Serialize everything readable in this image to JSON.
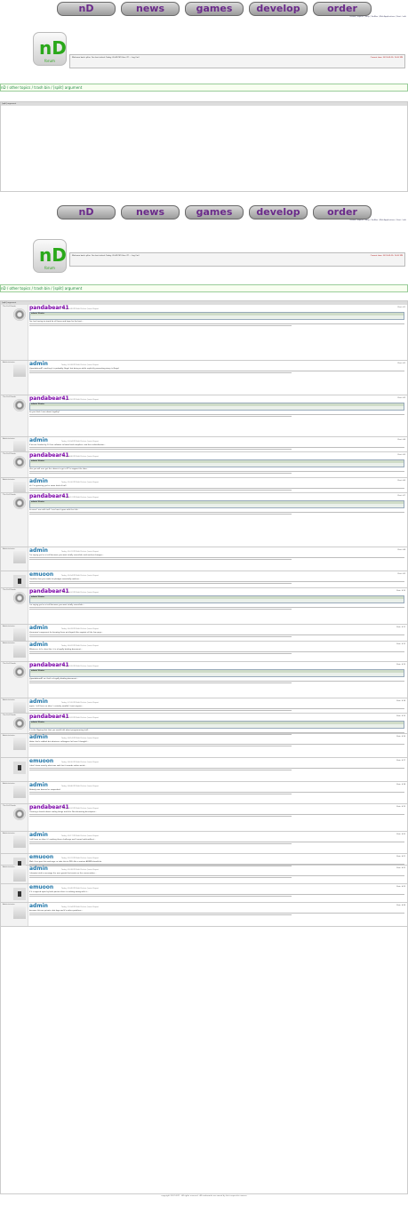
{
  "nav": {
    "buttons": [
      "nD",
      "news",
      "games",
      "develop",
      "order"
    ]
  },
  "toplinks": "Forum | Imprint | Help | ToolBox | Web Applications | Start / wiki",
  "welcome": {
    "text": "Welcome back, qilim. You last visited: Today, 09:49 PM (User CP — Log Out)",
    "sub": "View New Posts | View Today's Posts | Private Messages (Unread 0, Total 17)",
    "current_time": "Current time: 2011-09-15, 10:22 PM"
  },
  "breadcrumb": "nD / other topics / trash bin / [split] argument",
  "thread_title": "[split] argument",
  "posts": [
    {
      "user": "pandabear41",
      "role": "The Evil Panda",
      "type": "pb",
      "meta": "Today, 01:49 PM   Edit Delete Quote Report",
      "no": "Post: #1",
      "quote_by": "admin Wrote:",
      "text": "Yes, but having to stand for all hours and hope for the best..."
    },
    {
      "user": "admin",
      "role": "Administrator",
      "type": "ad",
      "meta": "Today, 02:08 PM   Edit Delete Quote Report",
      "no": "Post: #2",
      "quote_by": "",
      "text": "@pandabear41 cracking it is probably illegal, but doing so while explicitly promoting piracy is illegal."
    },
    {
      "user": "pandabear41",
      "role": "The Evil Panda",
      "type": "pb",
      "meta": "Today, 02:50 PM   Edit Delete Quote Report",
      "no": "Post: #3",
      "quote_by": "admin Wrote:",
      "text": "So you think I care about legality?"
    },
    {
      "user": "admin",
      "role": "Administrator",
      "type": "ad",
      "meta": "Today, 03:04 PM   Edit Delete Quote Report",
      "no": "Post: #4",
      "quote_by": "",
      "text": "If we are funded by 10 free software to board and compilers, and free redistribution..."
    },
    {
      "user": "pandabear41",
      "role": "The Evil Panda",
      "type": "pb",
      "meta": "Today, 04:40 PM   Edit Delete Quote Report",
      "no": "Post: #5",
      "quote_by": "admin Wrote:",
      "text": "Like you will ever get the chance to get a PC to support the idea..."
    },
    {
      "user": "admin",
      "role": "Administrator",
      "type": "ad",
      "meta": "Today, 05:00 PM   Edit Delete Quote Report",
      "no": "Post: #6",
      "quote_by": "",
      "text": "ok, I'm guessing you're some kind of troll."
    },
    {
      "user": "pandabear41",
      "role": "The Evil Panda",
      "type": "pb",
      "meta": "Today, 05:12 PM   Edit Delete Quote Report",
      "no": "Post: #7",
      "quote_by": "admin Wrote:",
      "text": "So were I one with troll. I see how it goes with the title..."
    },
    {
      "user": "admin",
      "role": "Administrator",
      "type": "ad",
      "meta": "Today, 05:31 PM   Edit Delete Quote Report",
      "no": "Post: #8",
      "quote_by": "",
      "text": "I'm saying you're a troll because you want totally unrealistic and useless changes..."
    },
    {
      "user": "emuoon",
      "role": "",
      "type": "em",
      "meta": "Today, 05:54 PM   Edit Delete Quote Report",
      "no": "Post: #9",
      "quote_by": "",
      "text": "Could be that you made his pledges essentially useless..."
    },
    {
      "user": "pandabear41",
      "role": "The Evil Panda",
      "type": "pb",
      "meta": "Today, 06:02 PM   Edit Delete Quote Report",
      "no": "Post: #10",
      "quote_by": "admin Wrote:",
      "text": "I'm saying you're a troll because you want totally unrealistic..."
    },
    {
      "user": "admin",
      "role": "Administrator",
      "type": "ad",
      "meta": "Today, 06:28 PM   Edit Delete Quote Report",
      "no": "Post: #11",
      "quote_by": "",
      "text": "@emuoon's argument for keeping these privileged titles against all the few guys..."
    },
    {
      "user": "admin",
      "role": "Administrator",
      "type": "ad",
      "meta": "Today, 06:41 PM   Edit Delete Quote Report",
      "no": "Post: #12",
      "quote_by": "",
      "text": "Whatever, let's close this, it is a legally binding document..."
    },
    {
      "user": "pandabear41",
      "role": "The Evil Panda",
      "type": "pb",
      "meta": "Today, 07:09 PM   Edit Delete Quote Report",
      "no": "Post: #13",
      "quote_by": "admin Wrote:",
      "text": "@pandabear41 so, that's a legally binding document..."
    },
    {
      "user": "admin",
      "role": "Administrator",
      "type": "ad",
      "meta": "Today, 07:26 PM   Edit Delete Quote Report",
      "no": "Post: #14",
      "quote_by": "",
      "text": "again, I still have no idea, I certainly wouldn't trust anyone..."
    },
    {
      "user": "pandabear41",
      "role": "The Evil Panda",
      "type": "pb",
      "meta": "Today, 07:41 PM   Edit Delete Quote Report",
      "no": "Post: #15",
      "quote_by": "admin Wrote:",
      "text": "It is the flipping that that you would talk about programming stuff..."
    },
    {
      "user": "admin",
      "role": "Administrator",
      "type": "ad",
      "meta": "Today, 08:14 PM   Edit Delete Quote Report",
      "no": "Post: #16",
      "quote_by": "",
      "text": "Haha, that's rubbish but whatever colleagues (at least I thought)..."
    },
    {
      "user": "emuoon",
      "role": "",
      "type": "em",
      "meta": "Today, 08:30 PM   Edit Delete Quote Report",
      "no": "Post: #17",
      "quote_by": "",
      "text": "I don't know exactly what was said, but it sounds rather weird..."
    },
    {
      "user": "admin",
      "role": "Administrator",
      "type": "ad",
      "meta": "Today, 08:46 PM   Edit Delete Quote Report",
      "no": "Post: #18",
      "quote_by": "",
      "text": "Nobody was banned or suspended."
    },
    {
      "user": "pandabear41",
      "role": "The Evil Panda",
      "type": "pb",
      "meta": "Today, 09:02 PM   Edit Delete Quote Report",
      "no": "Post: #19",
      "quote_by": "",
      "text": "Creating a hostile about coding things and this. Not alienating developers..."
    },
    {
      "user": "admin",
      "role": "Administrator",
      "type": "ad",
      "meta": "Today, 09:17 PM   Edit Delete Quote Report",
      "no": "Post: #20",
      "quote_by": "",
      "text": "I still have no idea, it's making these challenge and I sound unfriendliest..."
    },
    {
      "user": "emuoon",
      "role": "",
      "type": "em",
      "meta": "Today, 09:31 PM   Edit Delete Quote Report",
      "no": "Post: #21",
      "quote_by": "",
      "text": "Wait, then post this and argu, or take this to PM's like a mature ADMIN should do."
    },
    {
      "user": "admin",
      "role": "Administrator",
      "type": "ad",
      "meta": "Today, 09:38 PM   Edit Delete Quote Report",
      "no": "Post: #22",
      "quote_by": "",
      "text": "I already tried to message the user ganak that wrote on the conversation..."
    },
    {
      "user": "emuoon",
      "role": "",
      "type": "em",
      "meta": "Today, 09:49 PM   Edit Delete Quote Report",
      "no": "Post: #23",
      "quote_by": "",
      "text": "If it is agreed upon by both parties there is nothing wrong with it..."
    },
    {
      "user": "admin",
      "role": "Administrator",
      "type": "ad",
      "meta": "Today, 10:04 PM   Edit Delete Quote Report",
      "no": "Post: #24",
      "quote_by": "",
      "text": "because this are private chat logs and it's rather pointless..."
    }
  ],
  "footer": "copyright 2007-2011 · All rights reserved · All trademarks are owned by their respective owners"
}
